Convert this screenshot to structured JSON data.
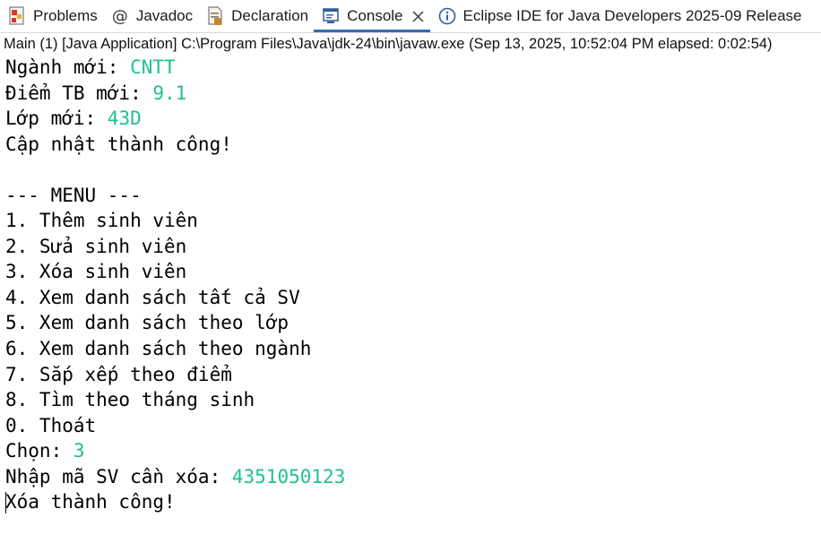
{
  "tabs": [
    {
      "label": "Problems",
      "icon": "problems-icon"
    },
    {
      "label": "Javadoc",
      "icon": "javadoc-at-icon"
    },
    {
      "label": "Declaration",
      "icon": "declaration-icon"
    },
    {
      "label": "Console",
      "icon": "console-icon",
      "active": true,
      "closable": true
    },
    {
      "label": "Eclipse IDE for Java Developers 2025-09 Release",
      "icon": "info-icon"
    }
  ],
  "launch_info": "Main (1) [Java Application] C:\\Program Files\\Java\\jdk-24\\bin\\javaw.exe  (Sep 13, 2025, 10:52:04 PM elapsed: 0:02:54)",
  "console_lines": [
    {
      "prompt": "Ngành mới: ",
      "input": "CNTT"
    },
    {
      "prompt": "Điểm TB mới: ",
      "input": "9.1"
    },
    {
      "prompt": "Lớp mới: ",
      "input": "43D"
    },
    {
      "prompt": "Cập nhật thành công!",
      "input": ""
    },
    {
      "prompt": "",
      "input": ""
    },
    {
      "prompt": "--- MENU ---",
      "input": ""
    },
    {
      "prompt": "1. Thêm sinh viên",
      "input": ""
    },
    {
      "prompt": "2. Sửa sinh viên",
      "input": ""
    },
    {
      "prompt": "3. Xóa sinh viên",
      "input": ""
    },
    {
      "prompt": "4. Xem danh sách tất cả SV",
      "input": ""
    },
    {
      "prompt": "5. Xem danh sách theo lớp",
      "input": ""
    },
    {
      "prompt": "6. Xem danh sách theo ngành",
      "input": ""
    },
    {
      "prompt": "7. Sắp xếp theo điểm",
      "input": ""
    },
    {
      "prompt": "8. Tìm theo tháng sinh",
      "input": ""
    },
    {
      "prompt": "0. Thoát",
      "input": ""
    },
    {
      "prompt": "Chọn: ",
      "input": "3"
    },
    {
      "prompt": "Nhập mã SV cần xóa: ",
      "input": "4351050123"
    },
    {
      "prompt": "Xóa thành công!",
      "input": ""
    }
  ],
  "colors": {
    "input_text": "#1fc28b",
    "active_tab_underline": "#2f6db5"
  }
}
